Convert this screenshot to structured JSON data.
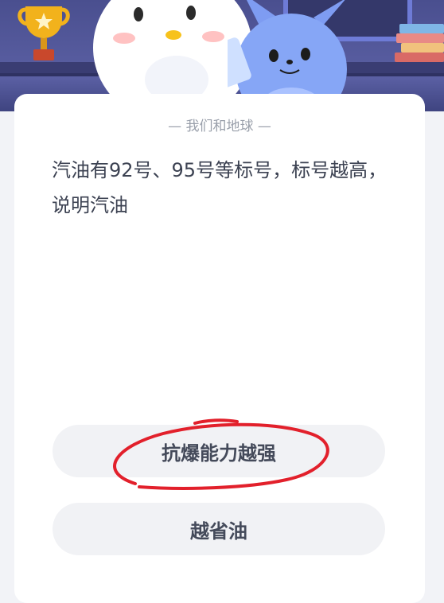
{
  "quiz": {
    "category": "— 我们和地球 —",
    "question": "汽油有92号、95号等标号，标号越高，说明汽油",
    "options": [
      {
        "label": "抗爆能力越强"
      },
      {
        "label": "越省油"
      }
    ]
  },
  "icons": [
    "trophy-icon",
    "books-icon"
  ],
  "colors": {
    "header": "#4a4f8f",
    "card": "#ffffff",
    "option_bg": "#f1f2f5",
    "text": "#3c4252",
    "annotation_red": "#e2202b"
  }
}
